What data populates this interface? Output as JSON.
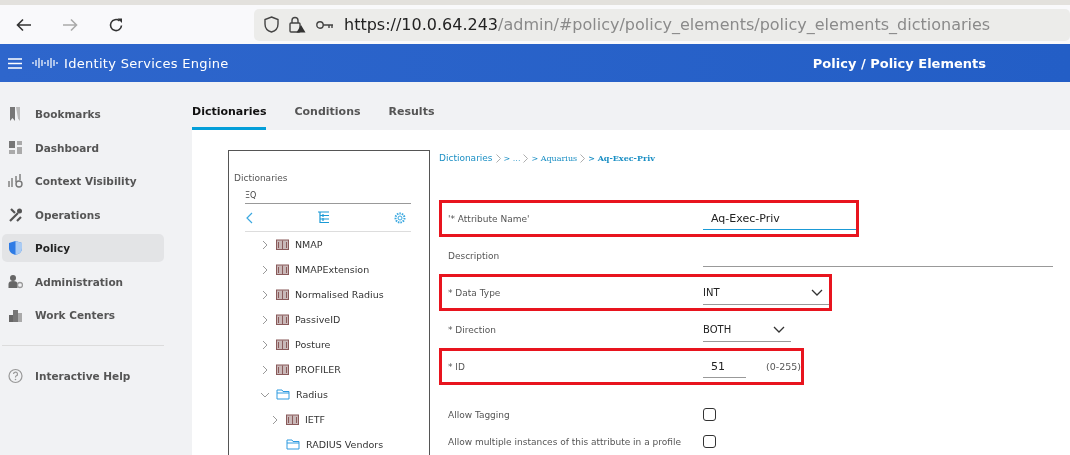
{
  "browser": {
    "url_host": "https://10.0.64.243",
    "url_path": "/admin/#policy/policy_elements/policy_elements_dictionaries"
  },
  "header": {
    "app_title": "Identity Services Engine",
    "page_title": "Policy / Policy Elements"
  },
  "sidebar": {
    "items": [
      {
        "label": "Bookmarks",
        "selected": false
      },
      {
        "label": "Dashboard",
        "selected": false
      },
      {
        "label": "Context Visibility",
        "selected": false
      },
      {
        "label": "Operations",
        "selected": false
      },
      {
        "label": "Policy",
        "selected": true
      },
      {
        "label": "Administration",
        "selected": false
      },
      {
        "label": "Work Centers",
        "selected": false
      }
    ],
    "help": "Interactive Help"
  },
  "tabs": [
    {
      "label": "Dictionaries",
      "selected": true
    },
    {
      "label": "Conditions",
      "selected": false
    },
    {
      "label": "Results",
      "selected": false
    }
  ],
  "tree": {
    "title": "Dictionaries",
    "search_placeholder": "ΞQ",
    "items": [
      {
        "label": "NMAP",
        "kind": "book",
        "expanded": false
      },
      {
        "label": "NMAPExtension",
        "kind": "book",
        "expanded": false
      },
      {
        "label": "Normalised Radius",
        "kind": "book",
        "expanded": false
      },
      {
        "label": "PassiveID",
        "kind": "book",
        "expanded": false
      },
      {
        "label": "Posture",
        "kind": "book",
        "expanded": false
      },
      {
        "label": "PROFILER",
        "kind": "book",
        "expanded": false
      },
      {
        "label": "Radius",
        "kind": "folder",
        "expanded": true,
        "children": [
          {
            "label": "IETF",
            "kind": "book",
            "expanded": false
          },
          {
            "label": "RADIUS Vendors",
            "kind": "folder"
          }
        ]
      }
    ]
  },
  "breadcrumb": [
    {
      "label": "Dictionaries"
    },
    {
      "label": "> ..."
    },
    {
      "label": "> Aquarius"
    },
    {
      "label": "> Aq-Exec-Priv",
      "current": true
    }
  ],
  "form": [
    {
      "kind": "text",
      "label": "'* Attribute Name'",
      "value": "Aq-Exec-Priv",
      "focused": true,
      "highlighted": true
    },
    {
      "kind": "text",
      "label": "Description",
      "focused": false,
      "highlighted": false
    },
    {
      "kind": "select",
      "label": "* Data Type",
      "value": "INT",
      "highlighted": true
    },
    {
      "kind": "select",
      "label": "* Direction",
      "value": "BOTH",
      "highlighted": false
    },
    {
      "kind": "number",
      "label": "* ID",
      "value": "51",
      "hint": "(0-255)",
      "highlighted": true
    },
    {
      "kind": "checkbox",
      "label": "Allow Tagging",
      "checked": false,
      "highlighted": false
    },
    {
      "kind": "checkbox",
      "label": "Allow multiple instances of this attribute in a profile",
      "checked": false,
      "highlighted": false
    }
  ]
}
